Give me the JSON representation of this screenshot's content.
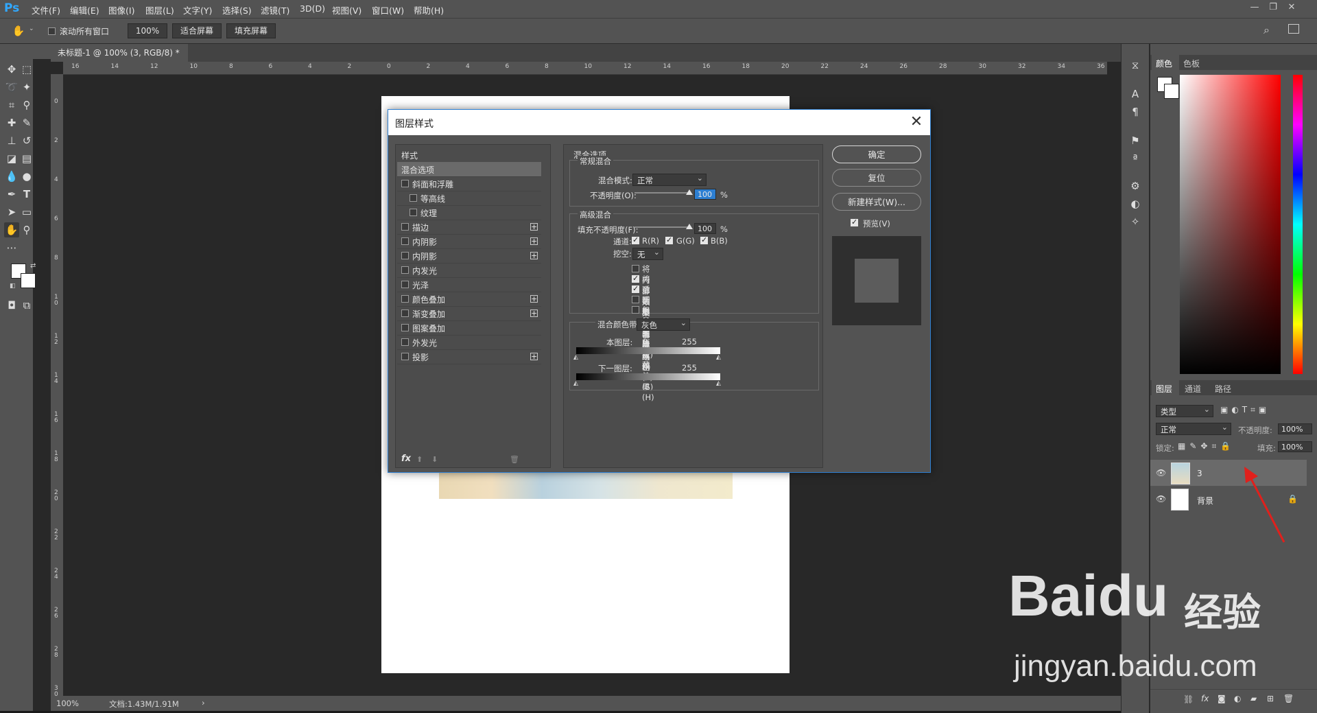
{
  "app": {
    "logo": "Ps",
    "menu": [
      "文件(F)",
      "编辑(E)",
      "图像(I)",
      "图层(L)",
      "文字(Y)",
      "选择(S)",
      "滤镜(T)",
      "3D(D)",
      "视图(V)",
      "窗口(W)",
      "帮助(H)"
    ],
    "window_controls": [
      "—",
      "❐",
      "✕"
    ]
  },
  "options_bar": {
    "scroll_all_label": "滚动所有窗口",
    "zoom_value": "100%",
    "fit_screen": "适合屏幕",
    "fill_screen": "填充屏幕"
  },
  "document": {
    "tab_title": "未标题-1 @ 100% (3, RGB/8) *",
    "tab_close": "×",
    "ruler_top": [
      "16",
      "14",
      "12",
      "10",
      "8",
      "6",
      "4",
      "2",
      "0",
      "2",
      "4",
      "6",
      "8",
      "10",
      "12",
      "14",
      "16",
      "18",
      "20",
      "22",
      "24",
      "26",
      "28",
      "30",
      "32",
      "34",
      "36"
    ],
    "ruler_left": [
      "0",
      "2",
      "4",
      "6",
      "8",
      "1\n0",
      "1\n2",
      "1\n4",
      "1\n6",
      "1\n8",
      "2\n0",
      "2\n2",
      "2\n4",
      "2\n6",
      "2\n8",
      "3\n0"
    ]
  },
  "status_bar": {
    "zoom": "100%",
    "doc_info": "文档:1.43M/1.91M",
    "arrow": "›"
  },
  "color_panel": {
    "tabs": [
      "颜色",
      "色板"
    ]
  },
  "layers_panel": {
    "tabs": [
      "图层",
      "通道",
      "路径"
    ],
    "filter_label": "类型",
    "blend_mode": "正常",
    "opacity_label": "不透明度:",
    "opacity_value": "100%",
    "lock_label": "锁定:",
    "fill_label": "填充:",
    "fill_value": "100%",
    "layers": [
      {
        "name": "3",
        "selected": true
      },
      {
        "name": "背景",
        "selected": false,
        "locked": true
      }
    ],
    "footer_icons": [
      "link-icon",
      "fx-icon",
      "mask-icon",
      "adjustment-icon",
      "folder-icon",
      "new-layer-icon",
      "trash-icon"
    ]
  },
  "dialog": {
    "title": "图层样式",
    "close": "✕",
    "style_list": [
      {
        "label": "样式",
        "checkbox": false,
        "plus": false,
        "indent": 0,
        "header": true
      },
      {
        "label": "混合选项",
        "checkbox": false,
        "plus": false,
        "indent": 0,
        "selected": true
      },
      {
        "label": "斜面和浮雕",
        "checkbox": true,
        "plus": false,
        "indent": 0
      },
      {
        "label": "等高线",
        "checkbox": true,
        "plus": false,
        "indent": 1
      },
      {
        "label": "纹理",
        "checkbox": true,
        "plus": false,
        "indent": 1
      },
      {
        "label": "描边",
        "checkbox": true,
        "plus": true,
        "indent": 0
      },
      {
        "label": "内阴影",
        "checkbox": true,
        "plus": true,
        "indent": 0
      },
      {
        "label": "内阴影",
        "checkbox": true,
        "plus": true,
        "indent": 0
      },
      {
        "label": "内发光",
        "checkbox": true,
        "plus": false,
        "indent": 0
      },
      {
        "label": "光泽",
        "checkbox": true,
        "plus": false,
        "indent": 0
      },
      {
        "label": "颜色叠加",
        "checkbox": true,
        "plus": true,
        "indent": 0
      },
      {
        "label": "渐变叠加",
        "checkbox": true,
        "plus": true,
        "indent": 0
      },
      {
        "label": "图案叠加",
        "checkbox": true,
        "plus": false,
        "indent": 0
      },
      {
        "label": "外发光",
        "checkbox": true,
        "plus": false,
        "indent": 0
      },
      {
        "label": "投影",
        "checkbox": true,
        "plus": true,
        "indent": 0
      }
    ],
    "fx_label": "fx",
    "blend_options": {
      "section_title": "混合选项",
      "general_title": "常规混合",
      "blend_mode_label": "混合模式:",
      "blend_mode_value": "正常",
      "opacity_label": "不透明度(O):",
      "opacity_value": "100",
      "percent": "%",
      "advanced_title": "高级混合",
      "fill_opacity_label": "填充不透明度(F):",
      "fill_opacity_value": "100",
      "channels_label": "通道:",
      "channels": [
        {
          "label": "R(R)",
          "checked": true
        },
        {
          "label": "G(G)",
          "checked": true
        },
        {
          "label": "B(B)",
          "checked": true
        }
      ],
      "knockout_label": "挖空:",
      "knockout_value": "无",
      "options": [
        {
          "label": "将内部效果混合成组(I)",
          "checked": false
        },
        {
          "label": "将剪贴图层混合成组(P)",
          "checked": true
        },
        {
          "label": "透明形状图层(T)",
          "checked": true
        },
        {
          "label": "图层蒙版隐藏效果(S)",
          "checked": false
        },
        {
          "label": "矢量蒙版隐藏效果(H)",
          "checked": false
        }
      ],
      "blend_if_label": "混合颜色带:",
      "blend_if_value": "灰色",
      "this_layer_label": "本图层:",
      "underlying_label": "下一图层:",
      "range_low": "0",
      "range_high": "255"
    },
    "buttons": {
      "ok": "确定",
      "reset": "复位",
      "new_style": "新建样式(W)...",
      "preview_label": "预览(V)",
      "preview_checked": true
    }
  },
  "watermark": {
    "brand": "Baidu",
    "suffix": "经验",
    "url": "jingyan.baidu.com"
  },
  "colors": {
    "panel_bg": "#535353",
    "canvas_bg": "#282828",
    "accent": "#2d7fd2",
    "annotation": "#e0201c"
  }
}
